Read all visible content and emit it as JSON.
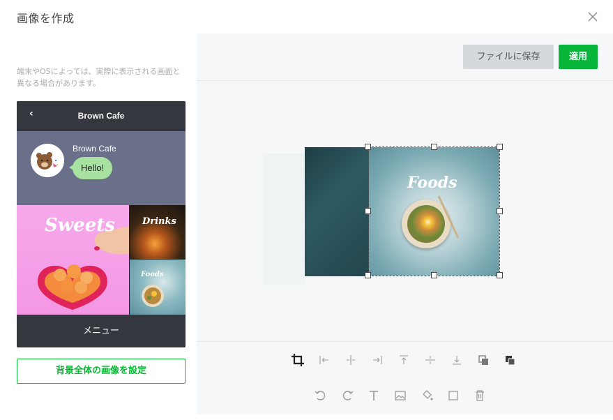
{
  "header": {
    "title": "画像を作成"
  },
  "left": {
    "notice": "端末やOSによっては、実際に表示される画面と異なる場合があります。",
    "phone": {
      "back": "‹",
      "title": "Brown Cafe",
      "chat_name": "Brown Cafe",
      "bubble": "Hello!",
      "tiles": {
        "sweets": "Sweets",
        "drinks": "Drinks",
        "foods": "Foods"
      },
      "menu": "メニュー"
    },
    "set_background_button": "背景全体の画像を設定"
  },
  "right": {
    "save_file_button": "ファイルに保存",
    "apply_button": "適用",
    "canvas_text": "Foods",
    "tools_row1": [
      "crop-icon",
      "align-left-icon",
      "align-center-horizontal-icon",
      "align-right-icon",
      "align-top-icon",
      "align-center-vertical-icon",
      "align-bottom-icon",
      "bring-forward-icon",
      "send-backward-icon"
    ],
    "tools_row2": [
      "undo-icon",
      "redo-icon",
      "text-icon",
      "image-icon",
      "fill-icon",
      "rectangle-icon",
      "delete-icon"
    ]
  },
  "colors": {
    "accent": "#07b53b",
    "phone_dark": "#34373d",
    "chat_bg": "#6a708a",
    "bubble": "#a7e2a0"
  }
}
